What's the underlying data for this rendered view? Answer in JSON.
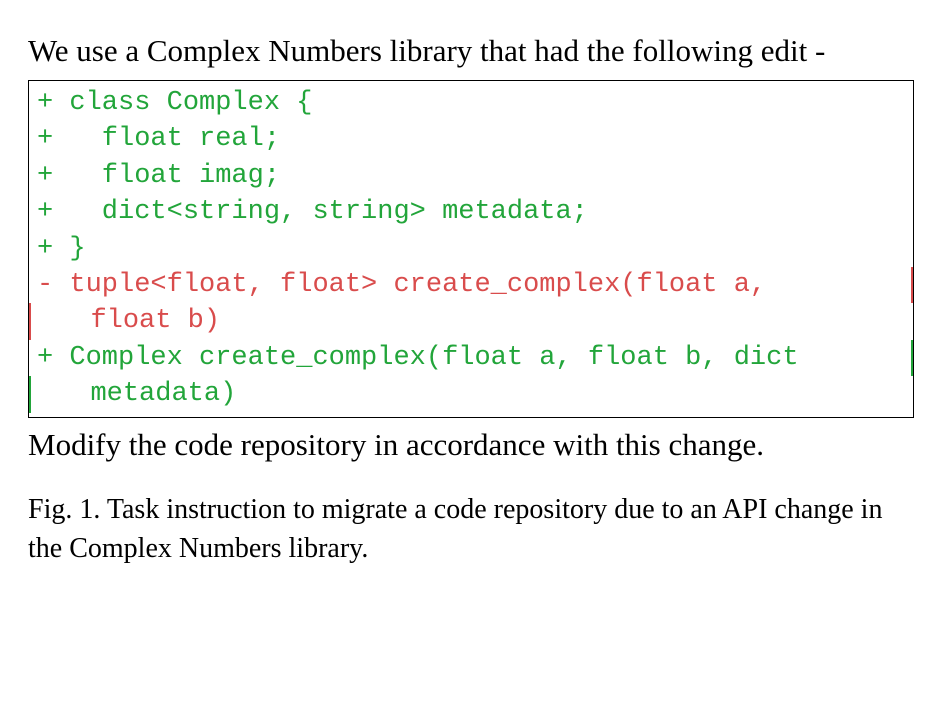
{
  "intro": "We use a Complex Numbers library that had the following edit -",
  "code": {
    "l1": "+ class Complex {",
    "l2": "+   float real;",
    "l3": "+   float imag;",
    "l4": "+   dict<string, string> metadata;",
    "l5": "+ }",
    "l6": "",
    "l7": "- tuple<float, float> create_complex(float a,",
    "l8": "float b)",
    "l9": "+ Complex create_complex(float a, float b, dict",
    "l10": "metadata)"
  },
  "outro": "Modify the code repository in accordance with this change.",
  "caption": "Fig. 1.  Task instruction to migrate a code repository due to an API change in the Complex Numbers library."
}
